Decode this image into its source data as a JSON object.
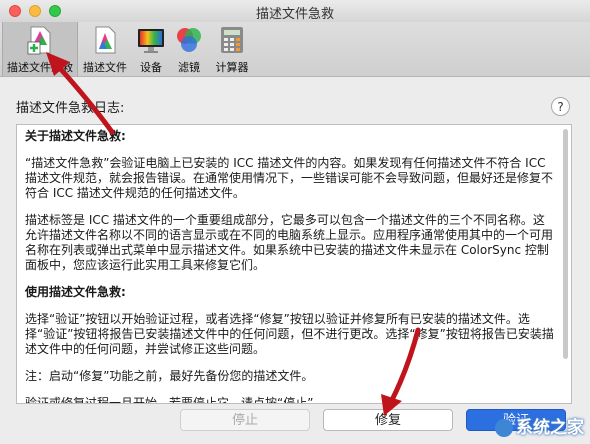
{
  "window": {
    "title": "描述文件急救"
  },
  "toolbar": {
    "items": [
      {
        "label": "描述文件急救",
        "icon": "first-aid-icon",
        "selected": true
      },
      {
        "label": "描述文件",
        "icon": "profile-icon"
      },
      {
        "label": "设备",
        "icon": "monitor-icon"
      },
      {
        "label": "滤镜",
        "icon": "filter-icon"
      },
      {
        "label": "计算器",
        "icon": "calculator-icon"
      }
    ]
  },
  "log": {
    "label": "描述文件急救日志:",
    "help": "?",
    "about_heading": "关于描述文件急救:",
    "para1": "“描述文件急救”会验证电脑上已安装的 ICC 描述文件的内容。如果发现有任何描述文件不符合 ICC 描述文件规范，就会报告错误。在通常使用情况下，一些错误可能不会导致问题，但最好还是修复不符合 ICC 描述文件规范的任何描述文件。",
    "para2": "描述标签是 ICC 描述文件的一个重要组成部分，它最多可以包含一个描述文件的三个不同名称。这允许描述文件名称以不同的语言显示或在不同的电脑系统上显示。应用程序通常使用其中的一个可用名称在列表或弹出式菜单中显示描述文件。如果系统中已安装的描述文件未显示在 ColorSync 控制面板中，您应该运行此实用工具来修复它们。",
    "usage_heading": "使用描述文件急救:",
    "para3": "选择“验证”按钮以开始验证过程，或者选择“修复”按钮以验证并修复所有已安装的描述文件。选择“验证”按钮将报告已安装描述文件中的任何问题，但不进行更改。选择“修复”按钮将报告已安装描述文件中的任何问题，并尝试修正这些问题。",
    "para4": "注：启动“修复”功能之前，最好先备份您的描述文件。",
    "para5": "验证或修复过程一旦开始，若要停止它，请点按“停止”。"
  },
  "buttons": {
    "stop": "停止",
    "repair": "修复",
    "verify": "验证"
  },
  "watermark": "系统之家",
  "colors": {
    "accent": "#2c6fe0",
    "annotation_arrow": "#c0141c"
  }
}
